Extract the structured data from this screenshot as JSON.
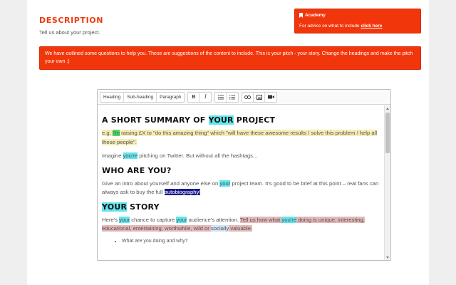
{
  "description": {
    "title": "Description",
    "subtitle": "Tell us about your project."
  },
  "academy": {
    "icon": "bookmark-icon",
    "title": "Academy",
    "text": "For advice on what to include ",
    "link": "click here"
  },
  "notice": {
    "text": "We have outlined some questions to help you. These are suggestions of the content to include. This is your pitch - your story. Change the headings and make the pitch your own :)"
  },
  "toolbar": {
    "heading": "Heading",
    "subheading": "Sub-heading",
    "paragraph": "Paragraph",
    "bold": "B",
    "italic": "I",
    "icons": [
      "bullet-list-icon",
      "numbered-list-icon",
      "link-icon",
      "image-icon",
      "video-icon"
    ]
  },
  "content": {
    "h1": {
      "pre": "A short summary of ",
      "hl": "your",
      "post": " project"
    },
    "p1": {
      "a": "e.g. ",
      "b": "I'm",
      "c": " raising £X to \"do this amazing thing\" which \"will have these awesome results / solve this problem / help all these people\"."
    },
    "p2": {
      "a": "Imagine ",
      "b": "you're",
      "c": " pitching on Twitter. But without all the hashtags..."
    },
    "h2": "Who are you?",
    "p3": {
      "a": "Give an intro about yourself and anyone else on ",
      "b": "your",
      "c": " project team. It's good to be brief at this point – real fans can always ask to buy the full ",
      "d": "autobiography!"
    },
    "h3": {
      "hl": "Your",
      "post": " story"
    },
    "p4": {
      "a": "Here's ",
      "b": "your",
      "c": " chance to capture ",
      "d": "your",
      "e": " audience's attention. ",
      "f": "Tell us how what ",
      "g": "you're",
      "h": " doing is unique, interesting, educational, entertaining, worthwhile, wild or ",
      "i": "socially",
      "j": " valuable."
    },
    "li1": "What are you doing and why?"
  },
  "colors": {
    "accent": "#f2360c",
    "highlight_cyan": "#62e6ee",
    "highlight_green": "#4cd964",
    "highlight_yellow": "#f7ecb5",
    "highlight_navy": "#1a1a8c",
    "highlight_pink": "#e4b8b8"
  }
}
